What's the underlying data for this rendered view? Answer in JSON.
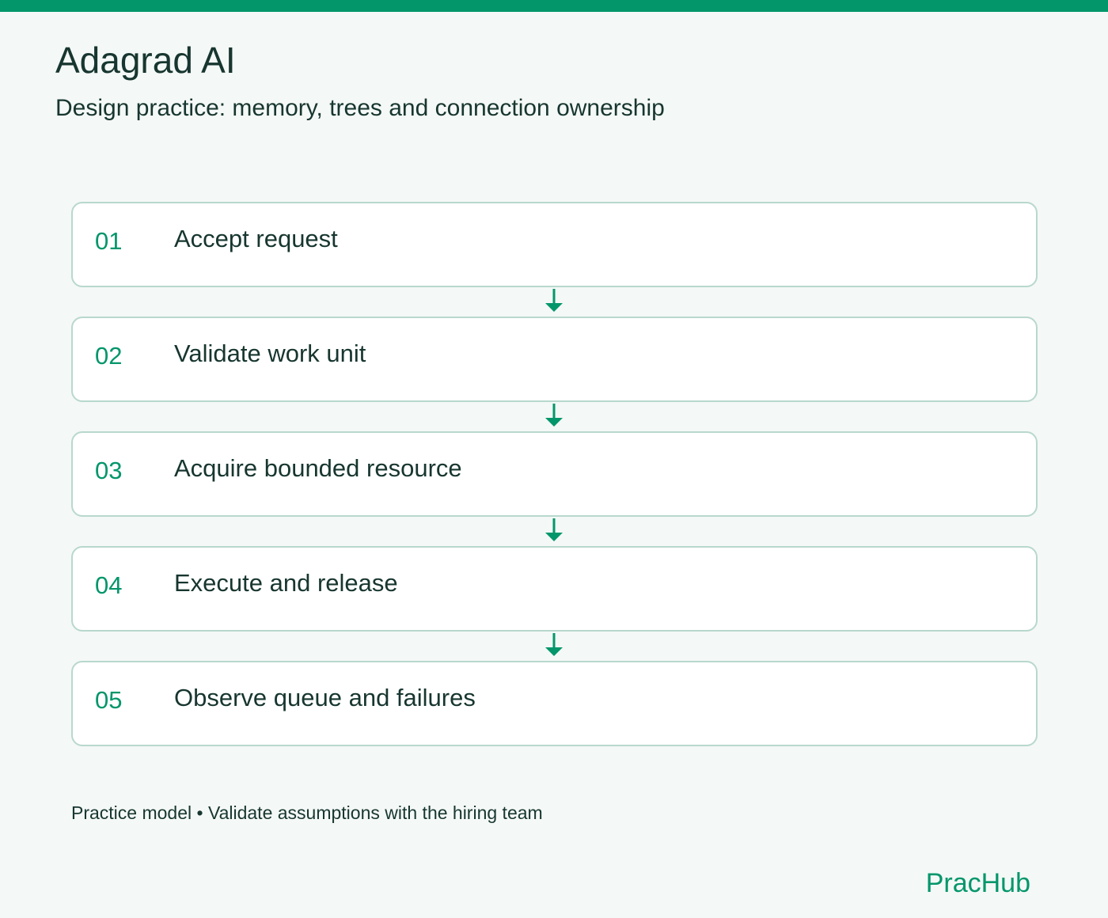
{
  "header": {
    "title": "Adagrad AI",
    "subtitle": "Design practice: memory, trees and connection ownership"
  },
  "steps": [
    {
      "number": "01",
      "label": "Accept request"
    },
    {
      "number": "02",
      "label": "Validate work unit"
    },
    {
      "number": "03",
      "label": "Acquire bounded resource"
    },
    {
      "number": "04",
      "label": "Execute and release"
    },
    {
      "number": "05",
      "label": "Observe queue and failures"
    }
  ],
  "footer": {
    "note": "Practice model • Validate assumptions with the hiring team",
    "brand": "PracHub"
  },
  "colors": {
    "accent": "#03966b",
    "text": "#17362f",
    "background": "#f4f8f6",
    "card_border": "#b8d8cd",
    "card_background": "#ffffff"
  }
}
